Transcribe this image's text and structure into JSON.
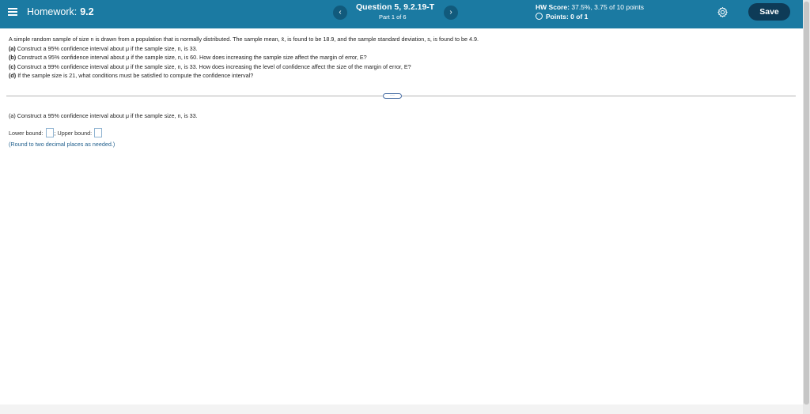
{
  "header": {
    "hw_label": "Homework:",
    "hw_name": "9.2",
    "question_title": "Question 5, 9.2.19-T",
    "question_part": "Part 1 of 6",
    "prev_glyph": "‹",
    "next_glyph": "›",
    "score_label": "HW Score:",
    "score_value": "37.5%, 3.75 of 10 points",
    "points_text": "Points: 0 of 1",
    "save_label": "Save",
    "colors": {
      "bar": "#1b7aa2",
      "save": "#0e3b57"
    }
  },
  "problem": {
    "intro": "A simple random sample of size n is drawn from a population that is normally distributed. The sample mean, x̄, is found to be 18.9, and the sample standard deviation, s, is found to be 4.9.",
    "a_label": "(a)",
    "a_text": "Construct a 95% confidence interval about μ if the sample size, n, is 33.",
    "b_label": "(b)",
    "b_text": "Construct a 95% confidence interval about μ if the sample size, n, is 60. How does increasing the sample size affect the margin of error, E?",
    "c_label": "(c)",
    "c_text": "Construct a 99% confidence interval about μ if the sample size, n, is 33. How does increasing the level of confidence affect the size of the margin of error, E?",
    "d_label": "(d)",
    "d_text": "If the sample size is 21, what conditions must be satisfied to compute the confidence interval?"
  },
  "divider_glyph": "···",
  "part_a": {
    "text": "(a) Construct a 95% confidence interval about μ if the sample size, n, is 33.",
    "lower_label": "Lower bound:",
    "upper_label": "; Upper bound:",
    "hint": "(Round to two decimal places as needed.)"
  }
}
